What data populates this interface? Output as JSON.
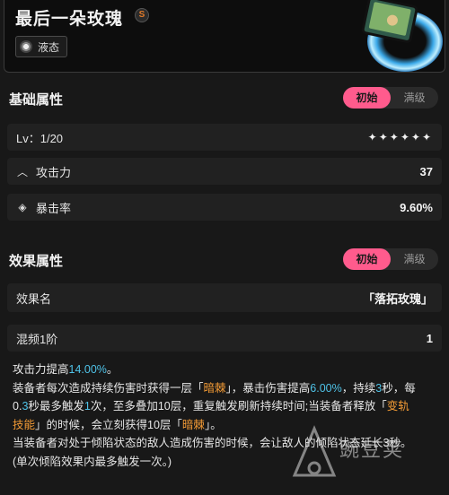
{
  "header": {
    "title": "最后一朵玫瑰",
    "rank": "S",
    "attribute_tag": "液态",
    "colors": {
      "title": "#f2f2f2",
      "rank": "#e07a2a"
    }
  },
  "base_section": {
    "title": "基础属性",
    "toggle": [
      "初始",
      "满级"
    ],
    "selected": "初始",
    "level_label": "Lv：1/20",
    "stars": "✦✦✦✦✦✦",
    "stats": [
      {
        "icon": "chevron-up-icon",
        "label": "攻击力",
        "value": "37"
      },
      {
        "icon": "crit-target-icon",
        "label": "暴击率",
        "value": "9.60%"
      }
    ]
  },
  "effect_section": {
    "title": "效果属性",
    "toggle": [
      "初始",
      "满级"
    ],
    "selected": "初始",
    "name_label": "效果名",
    "name_value": "「落拓玫瑰」",
    "tier_label": "混频1阶",
    "tier_value": "1"
  },
  "description": {
    "l1": [
      "攻击力提高",
      "14.00%",
      "。"
    ],
    "l2": [
      "装备者每次造成持续伤害时获得一层「",
      "暗棘",
      "」，暴击伤害提高",
      "6.00%",
      "，持续",
      "3",
      "秒，每"
    ],
    "l3": [
      "0.",
      "3",
      "秒最多触发",
      "1",
      "次，至多叠加10层，重复触发刷新持续时间;当装备者释放「",
      "变轨"
    ],
    "l4": [
      "技能",
      "」的时候，会立刻获得10层「",
      "暗棘",
      "」。"
    ],
    "l5": "当装备者对处于倾陷状态的敌人造成伤害的时候，会让敌人的倾陷状态延长3秒。",
    "l6": "(单次倾陷效果内最多触发一次。)"
  },
  "watermark": {
    "text": "豌豆荚"
  },
  "colors": {
    "accent": "#ff5b8d",
    "highlight_blue": "#4fc3e8",
    "highlight_orange": "#f29a35",
    "background": "#181818",
    "row": "#212121"
  }
}
